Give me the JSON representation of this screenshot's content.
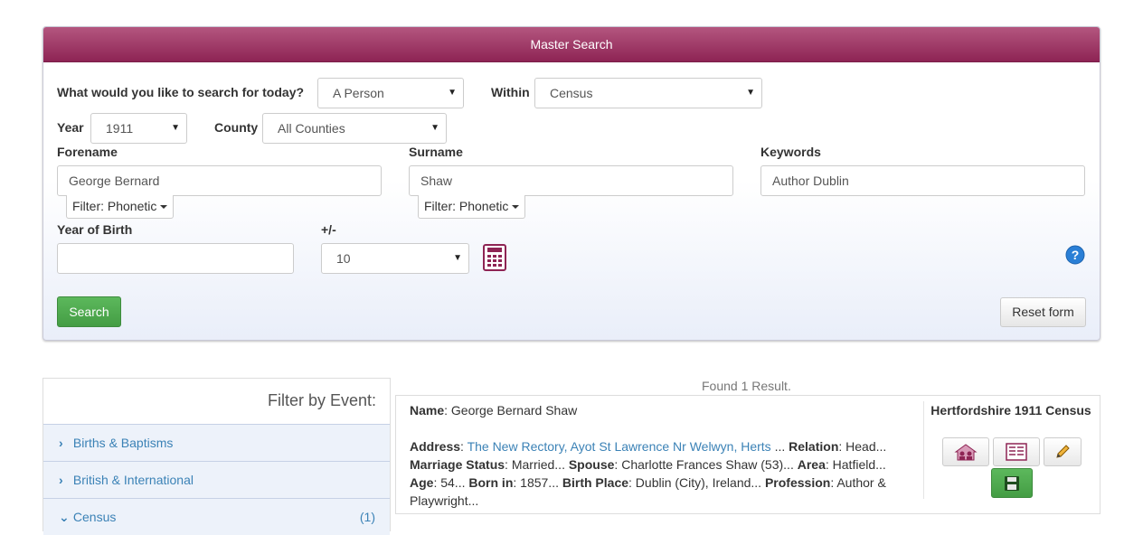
{
  "panel": {
    "title": "Master Search",
    "search_question": "What would you like to search for today?",
    "search_for": "A Person",
    "within_label": "Within",
    "within": "Census",
    "year_label": "Year",
    "year": "1911",
    "county_label": "County",
    "county": "All Counties",
    "forename_label": "Forename",
    "forename": "George Bernard",
    "forename_filter": "Filter: Phonetic",
    "surname_label": "Surname",
    "surname": "Shaw",
    "surname_filter": "Filter: Phonetic",
    "keywords_label": "Keywords",
    "keywords": "Author Dublin",
    "yob_label": "Year of Birth",
    "yob": "",
    "range_label": "+/-",
    "range": "10",
    "search_button": "Search",
    "reset_button": "Reset form",
    "accent_color": "#9b2d5f",
    "icons": [
      "calculator-icon",
      "help-icon"
    ]
  },
  "filter_panel": {
    "title": "Filter by Event:",
    "events": [
      {
        "label": "Births & Baptisms",
        "expanded": false,
        "count": ""
      },
      {
        "label": "British & International",
        "expanded": false,
        "count": ""
      },
      {
        "label": "Census",
        "expanded": true,
        "count": "(1)"
      }
    ]
  },
  "results": {
    "found_text": "Found 1 Result.",
    "record": {
      "name_label": "Name",
      "name": "George Bernard Shaw",
      "address_label": "Address",
      "address": "The New Rectory, Ayot St Lawrence Nr Welwyn, Herts",
      "relation_label": "Relation",
      "relation": "Head...",
      "marriage_label": "Marriage Status",
      "marriage": "Married...",
      "spouse_label": "Spouse",
      "spouse": "Charlotte Frances Shaw (53)...",
      "area_label": "Area",
      "area": "Hatfield...",
      "age_label": "Age",
      "age": "54...",
      "born_label": "Born in",
      "born": "1857...",
      "birthplace_label": "Birth Place",
      "birthplace": "Dublin (City), Ireland...",
      "profession_label": "Profession",
      "profession": "Author &",
      "profession_cont": "Playwright...",
      "census_title": "Hertfordshire 1911 Census",
      "action_icons": [
        "household-icon",
        "transcript-icon",
        "edit-icon",
        "save-icon"
      ]
    }
  }
}
